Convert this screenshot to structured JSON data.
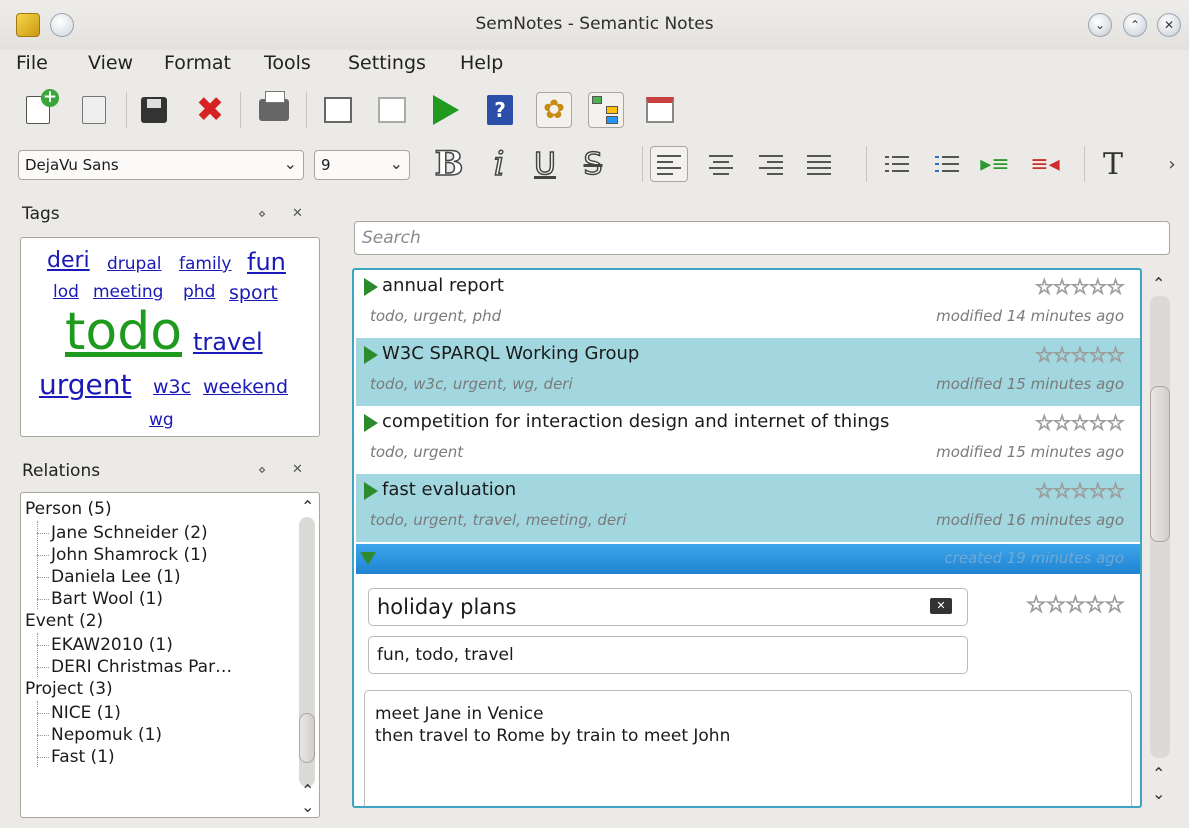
{
  "window": {
    "title": "SemNotes - Semantic Notes"
  },
  "menu": [
    "File",
    "View",
    "Format",
    "Tools",
    "Settings",
    "Help"
  ],
  "format": {
    "font": "DejaVu Sans",
    "size": "9"
  },
  "tags_panel": {
    "title": "Tags",
    "tags": [
      "deri",
      "drupal",
      "family",
      "fun",
      "lod",
      "meeting",
      "phd",
      "sport",
      "todo",
      "travel",
      "urgent",
      "w3c",
      "weekend",
      "wg"
    ]
  },
  "relations_panel": {
    "title": "Relations",
    "groups": [
      {
        "label": "Person (5)",
        "items": [
          "Jane Schneider (2)",
          "John Shamrock (1)",
          "Daniela Lee (1)",
          "Bart Wool (1)"
        ]
      },
      {
        "label": "Event (2)",
        "items": [
          "EKAW2010 (1)",
          "DERI Christmas Par…"
        ]
      },
      {
        "label": "Project (3)",
        "items": [
          "NICE (1)",
          "Nepomuk (1)",
          "Fast (1)"
        ]
      }
    ]
  },
  "search": {
    "placeholder": "Search"
  },
  "notes": [
    {
      "title": "annual report",
      "tags": "todo, urgent, phd",
      "modified": "modified  14 minutes ago",
      "selected": false
    },
    {
      "title": "W3C SPARQL Working Group",
      "tags": "todo, w3c, urgent, wg, deri",
      "modified": "modified  15 minutes ago",
      "selected": true
    },
    {
      "title": "competition for interaction design and internet of things",
      "tags": "todo, urgent",
      "modified": "modified  15 minutes ago",
      "selected": false
    },
    {
      "title": "fast evaluation",
      "tags": "todo, urgent, travel, meeting, deri",
      "modified": "modified  16 minutes ago",
      "selected": true
    }
  ],
  "editor": {
    "created": "created  19 minutes ago",
    "title": "holiday plans",
    "tags": "fun, todo, travel",
    "body": [
      "meet Jane in Venice",
      "then travel to Rome by train to meet John"
    ]
  },
  "stars": "☆☆☆☆☆"
}
